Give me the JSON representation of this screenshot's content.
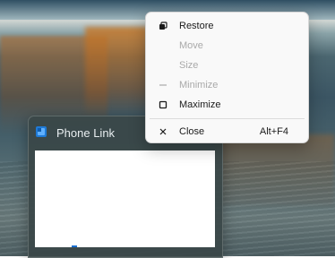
{
  "window": {
    "title": "Phone Link"
  },
  "system_menu": {
    "items": [
      {
        "label": "Restore",
        "icon": "restore-icon",
        "enabled": true,
        "shortcut": ""
      },
      {
        "label": "Move",
        "icon": "",
        "enabled": false,
        "shortcut": ""
      },
      {
        "label": "Size",
        "icon": "",
        "enabled": false,
        "shortcut": ""
      },
      {
        "label": "Minimize",
        "icon": "minimize-icon",
        "enabled": false,
        "shortcut": ""
      },
      {
        "label": "Maximize",
        "icon": "maximize-icon",
        "enabled": true,
        "shortcut": ""
      },
      {
        "label": "Close",
        "icon": "close-icon",
        "enabled": true,
        "shortcut": "Alt+F4"
      }
    ]
  },
  "colors": {
    "app_icon_blue": "#1f7ad6",
    "menu_background": "#f9f9f9",
    "disabled_text": "#a9a9a9"
  }
}
